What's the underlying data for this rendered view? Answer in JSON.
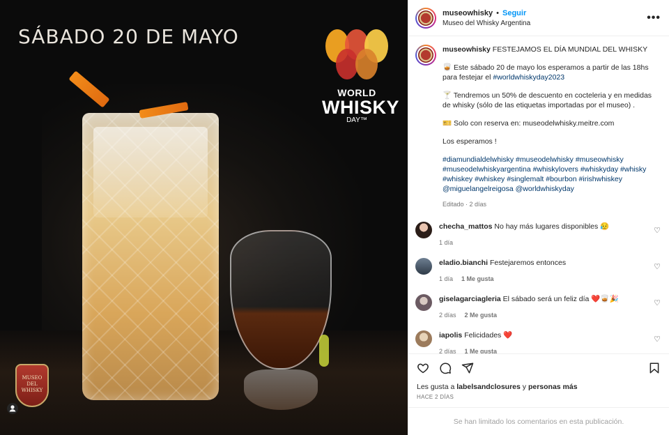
{
  "photo": {
    "date_text": "SÁBADO 20 DE MAYO",
    "logo": {
      "line1": "WORLD",
      "line2": "WHISKY",
      "line3": "DAY™"
    },
    "badge_text": [
      "MUSEO",
      "DEL",
      "WHISKY"
    ]
  },
  "header": {
    "username": "museowhisky",
    "separator": "•",
    "follow_label": "Seguir",
    "subtitle": "Museo del Whisky Argentina",
    "more_icon": "more-horizontal-icon"
  },
  "caption": {
    "username": "museowhisky",
    "title": "FESTEJAMOS EL DÍA MUNDIAL DEL WHISKY",
    "p1": "🥃 Este sábado 20 de mayo los esperamos a partir de las 18hs para festejar el ",
    "p1_tag": "#worldwhiskyday2023",
    "p2": "🍸 Tendremos un 50% de descuento en cocteleria y en medidas de whisky (sólo de las etiquetas importadas por el museo) .",
    "p3": "🎫 Solo con reserva en: museodelwhisky.meitre.com",
    "p4": "Los esperamos !",
    "hashtags": "#diamundialdelwhisky #museodelwhisky #museowhisky #museodelwhiskyargentina #whiskylovers #whiskyday #whisky #whiskey #whiskey #singlemalt #bourbon #irishwhiskey @miguelangelreigosa @worldwhiskyday",
    "meta": "Editado · 2 días"
  },
  "comments": [
    {
      "user": "checha_mattos",
      "text": "No hay más lugares disponibles 😥",
      "time": "1 día",
      "likes": ""
    },
    {
      "user": "eladio.bianchi",
      "text": "Festejaremos entonces",
      "time": "1 día",
      "likes": "1 Me gusta"
    },
    {
      "user": "giselagarciagleria",
      "text": "El sábado será un feliz día ❤️🥃🎉",
      "time": "2 días",
      "likes": "2 Me gusta"
    },
    {
      "user": "iapolis",
      "text": "Felicidades ❤️",
      "time": "2 días",
      "likes": "1 Me gusta"
    }
  ],
  "actions": {
    "like_icon": "heart-icon",
    "comment_icon": "comment-icon",
    "share_icon": "share-icon",
    "save_icon": "bookmark-icon"
  },
  "likes": {
    "prefix": "Les gusta a ",
    "user": "labelsandclosures",
    "middle": " y ",
    "others": "personas más"
  },
  "posted_ago": "HACE 2 DÍAS",
  "comments_limited": "Se han limitado los comentarios en esta publicación.",
  "colors": {
    "accent": "#0095f6",
    "link": "#00376b",
    "muted": "#737373"
  }
}
